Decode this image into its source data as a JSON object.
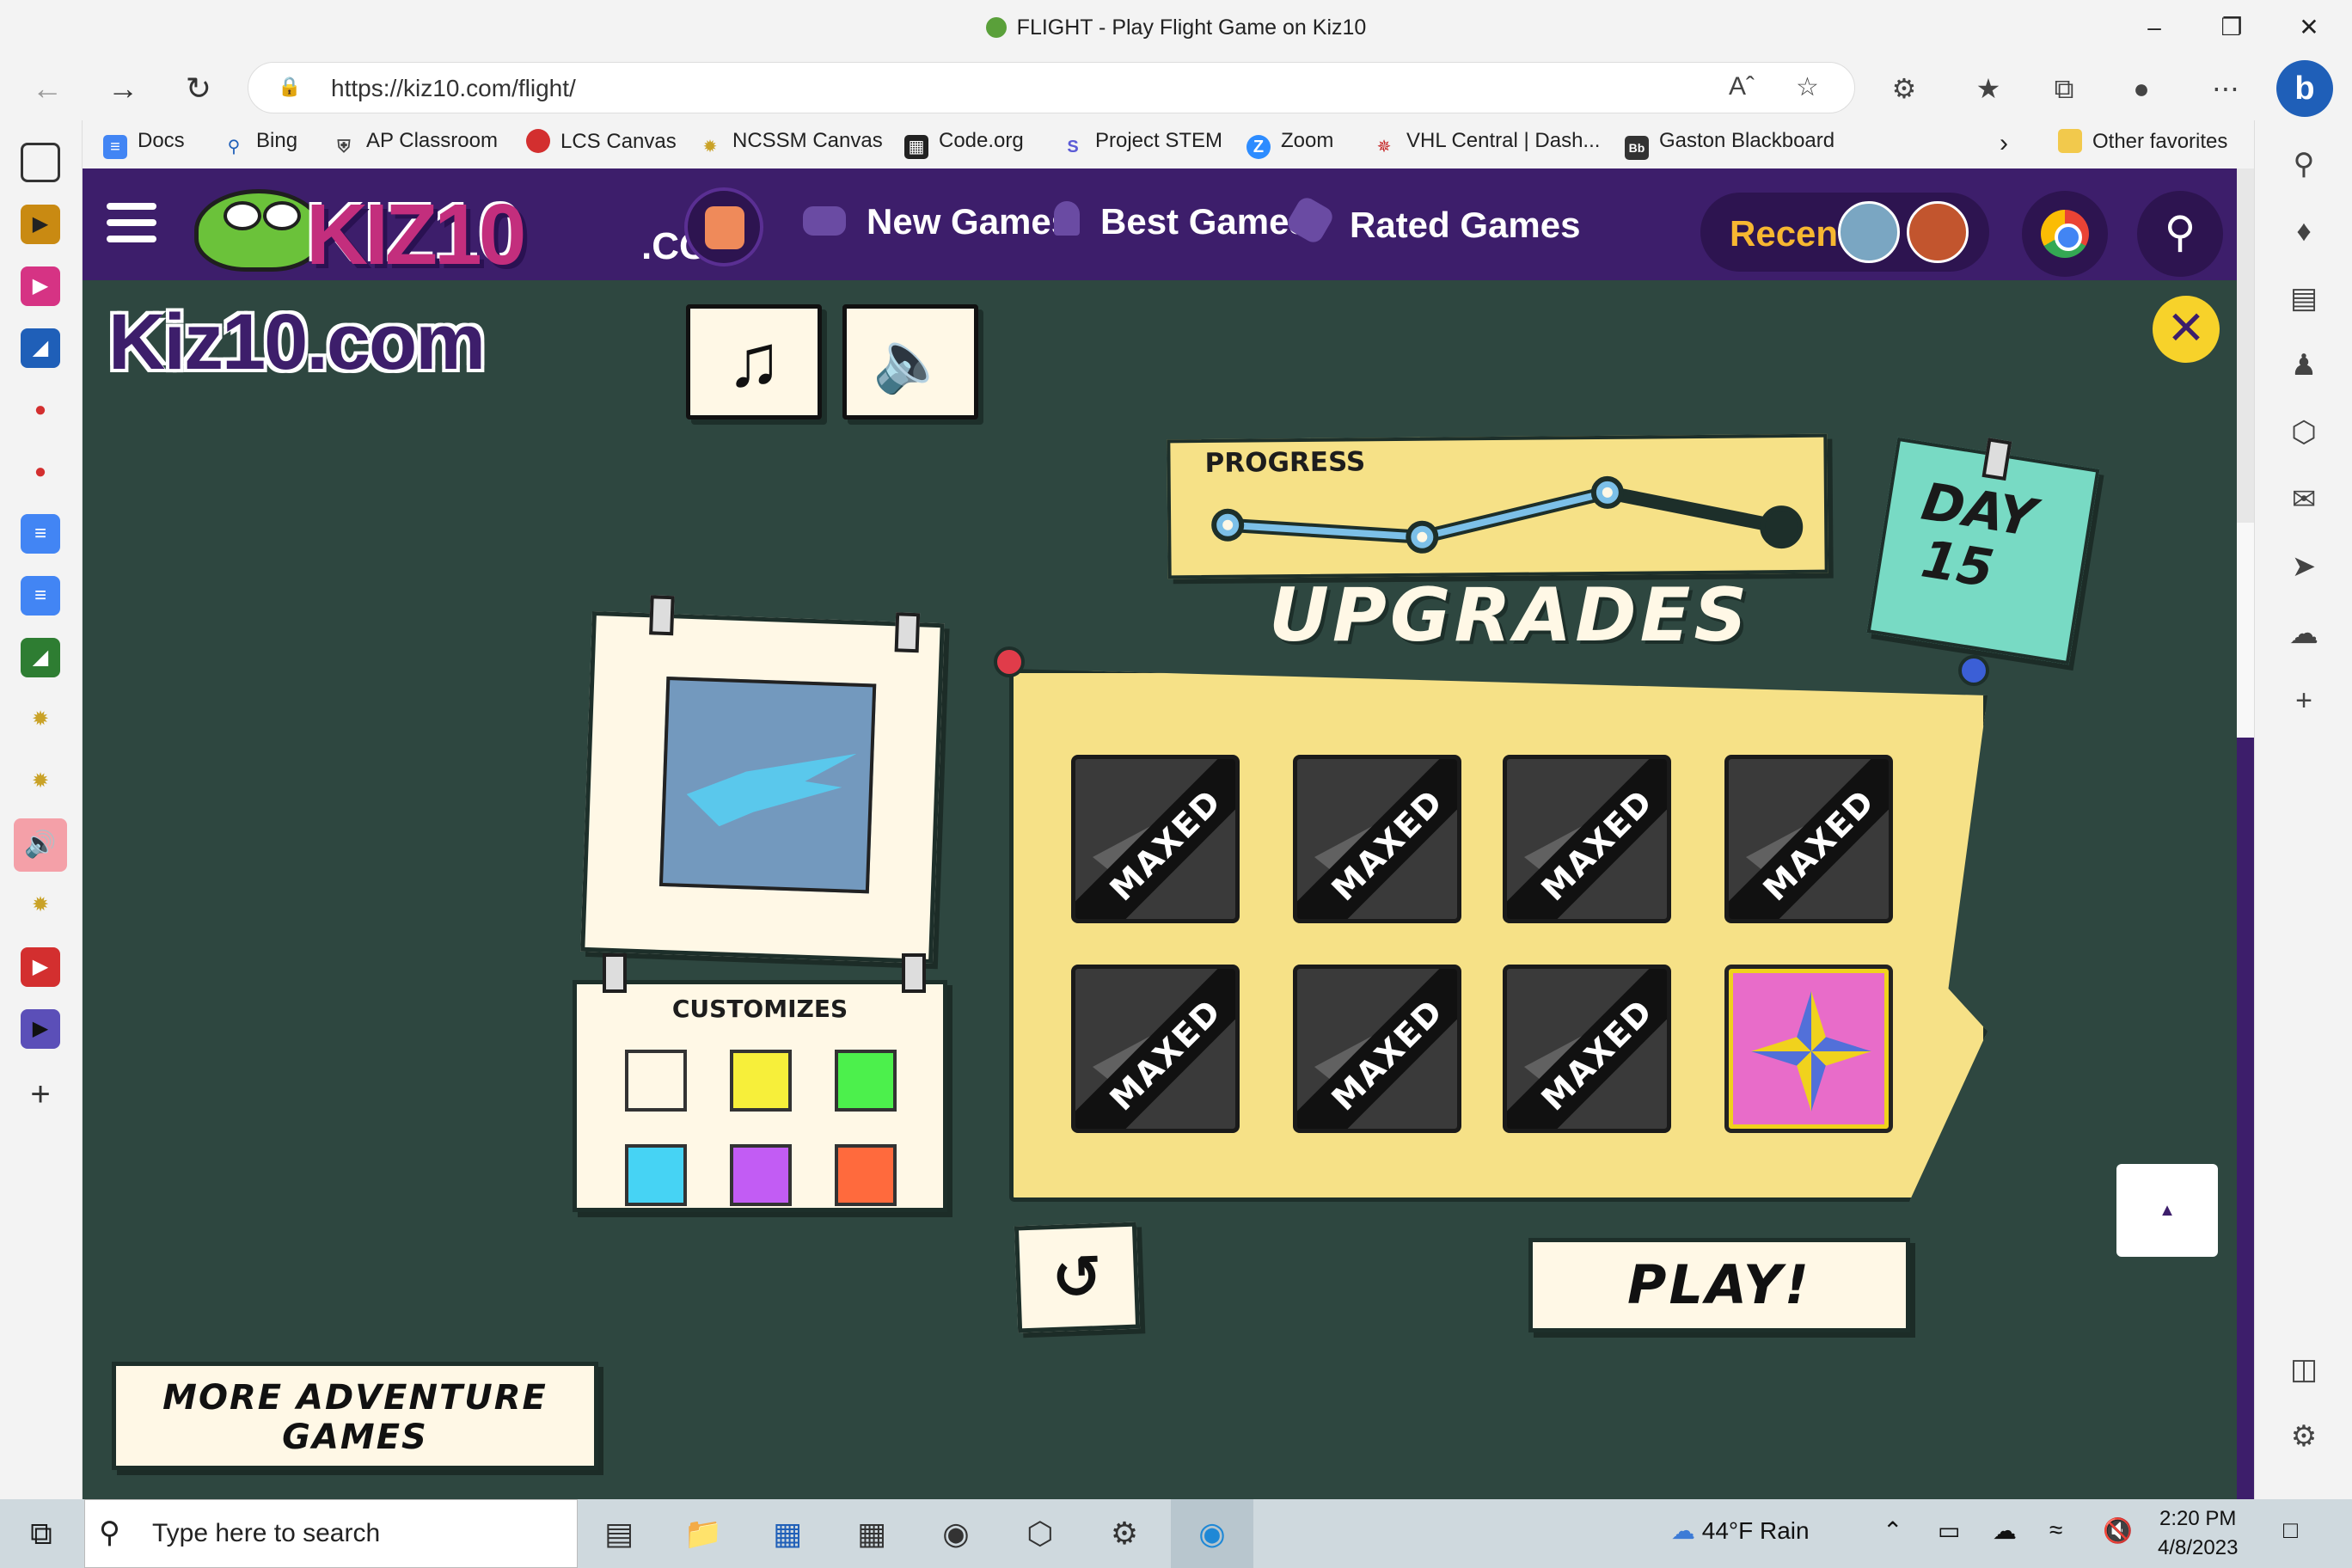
{
  "browser": {
    "window_title": "FLIGHT - Play Flight Game on Kiz10",
    "url": "https://kiz10.com/flight/",
    "favorites": [
      {
        "label": "Docs",
        "icon": "docs-icon",
        "color": "#4285f4"
      },
      {
        "label": "Bing",
        "icon": "search-icon",
        "color": "#1f5fb8"
      },
      {
        "label": "AP Classroom",
        "icon": "shield-icon",
        "color": "#444444"
      },
      {
        "label": "LCS Canvas",
        "icon": "apple-icon",
        "color": "#d32f2f"
      },
      {
        "label": "NCSSM Canvas",
        "icon": "star-icon",
        "color": "#c9a227"
      },
      {
        "label": "Code.org",
        "icon": "grid-icon",
        "color": "#222222"
      },
      {
        "label": "Project STEM",
        "icon": "s-icon",
        "color": "#5b5bd6"
      },
      {
        "label": "Zoom",
        "icon": "zoom-icon",
        "color": "#2d8cff"
      },
      {
        "label": "VHL Central | Dash...",
        "icon": "vhl-icon",
        "color": "#c62828"
      },
      {
        "label": "Gaston Blackboard",
        "icon": "blackboard-icon",
        "color": "#333333"
      }
    ],
    "other_favorites": "Other favorites"
  },
  "site": {
    "nav": {
      "new_games": "New Games",
      "best_games": "Best Games",
      "rated_games": "Rated Games",
      "recent": "Recent"
    },
    "logo_text": "KIZ10",
    "logo_com": ".COM"
  },
  "game": {
    "brand": "Kiz10.com",
    "progress_label": "PROGRESS",
    "progress": {
      "completed_stages": 3,
      "total_stages": 4
    },
    "day_label": "DAY",
    "day_number": "15",
    "upgrades_title": "UPGRADES",
    "maxed_label": "MAXED",
    "upgrades": [
      {
        "status": "MAXED"
      },
      {
        "status": "MAXED"
      },
      {
        "status": "MAXED"
      },
      {
        "status": "MAXED"
      },
      {
        "status": "MAXED"
      },
      {
        "status": "MAXED"
      },
      {
        "status": "MAXED"
      },
      {
        "status": "available"
      }
    ],
    "customizes_label": "CUSTOMIZES",
    "swatches": [
      "#fff8e6",
      "#f7ef3a",
      "#4cf04c",
      "#46d3f4",
      "#c25cf4",
      "#ff6a3d"
    ],
    "play_label": "PLAY!",
    "more_games_label": "MORE ADVENTURE GAMES"
  },
  "taskbar": {
    "search_placeholder": "Type here to search",
    "weather": "44°F  Rain",
    "time": "2:20 PM",
    "date": "4/8/2023"
  }
}
